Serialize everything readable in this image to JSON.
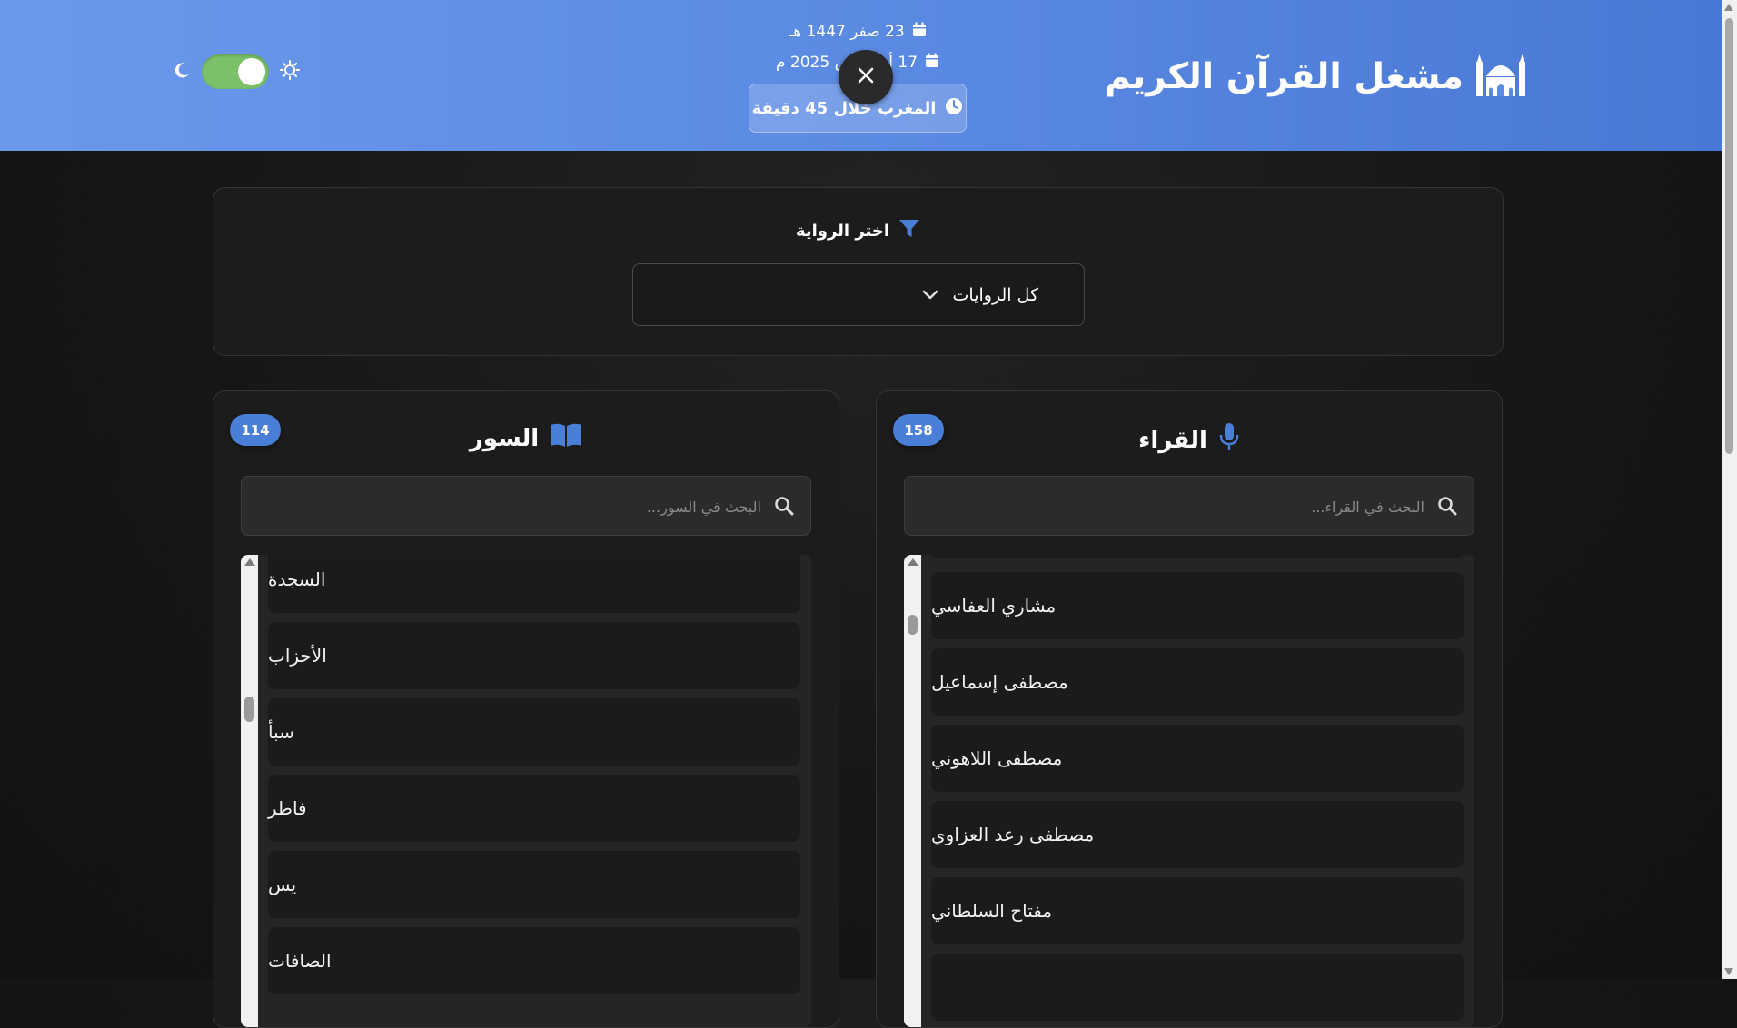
{
  "header": {
    "title": "مشغل القرآن الكريم",
    "hijri_date": "23 صفر 1447 هـ",
    "gregorian_date": "17 أغسطس 2025 م",
    "prayer_status": "المغرب خلال 45 دقيقة",
    "theme_toggle_on": true
  },
  "filter": {
    "label": "اختر الرواية",
    "selected": "كل الروايات"
  },
  "surahs": {
    "title": "السور",
    "count": "114",
    "search_placeholder": "البحث في السور...",
    "items": [
      "السجدة",
      "الأحزاب",
      "سبأ",
      "فاطر",
      "يس",
      "الصافات"
    ]
  },
  "reciters": {
    "title": "القراء",
    "count": "158",
    "search_placeholder": "البحث في القراء...",
    "items": [
      "مشاري العفاسي",
      "مصطفى إسماعيل",
      "مصطفى اللاهوني",
      "مصطفى رعد العزاوي",
      "مفتاح السلطاني"
    ]
  },
  "colors": {
    "header_gradient_start": "#6a98ea",
    "header_gradient_end": "#4a78d6",
    "accent": "#4a7fd8",
    "toggle_on": "#7cc06a",
    "background": "#161616"
  }
}
